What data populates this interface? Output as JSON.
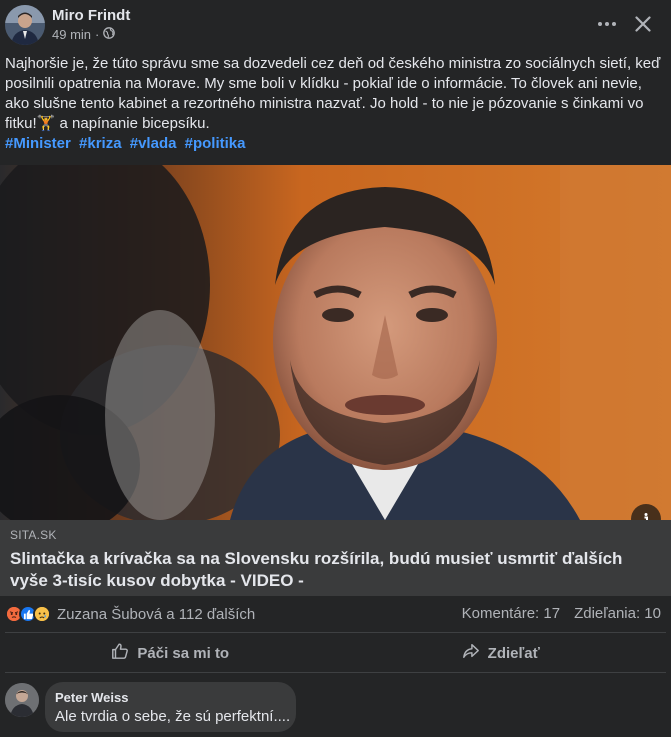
{
  "post": {
    "author": "Miro Frindt",
    "time": "49 min",
    "separator": "·",
    "text_lines": [
      "Najhoršie je, že túto správu sme sa dozvedeli cez deň od českého ministra zo sociálnych sietí, keď",
      "posilnili opatrenia na Morave. My sme boli v klídku - pokiaľ ide o informácie. To človek ani nevie,",
      "ako slušne tento kabinet a rezortného ministra nazvať. Jo hold - to nie je pózovanie s činkami vo",
      "fitku!🏋 a napínanie bicepsíku."
    ],
    "hashtags": [
      "#Minister",
      "#kriza",
      "#vlada",
      "#politika"
    ]
  },
  "link": {
    "source": "SITA.SK",
    "title": "Slintačka a krívačka sa na Slovensku rozšírila, budú musieť usmrtiť ďalších vyše 3-tisíc kusov dobytka - VIDEO -"
  },
  "reactions": {
    "names": "Zuzana Šubová a 112 ďalších",
    "comments": "Komentáre: 17",
    "shares": "Zdieľania: 10"
  },
  "actions": {
    "like": "Páči sa mi to",
    "share": "Zdieľať"
  },
  "comment": {
    "author": "Peter Weiss",
    "text": "Ale tvrdia o sebe, že sú perfektní...."
  },
  "colors": {
    "background": "#242526",
    "link_box": "#3a3b3c",
    "hashtag": "#4599ff",
    "secondary_text": "#b0b3b8"
  },
  "icons": [
    "globe-icon",
    "more-options-icon",
    "close-icon",
    "info-icon",
    "angry-reaction-icon",
    "like-reaction-icon",
    "sad-reaction-icon",
    "like-icon",
    "share-icon"
  ]
}
